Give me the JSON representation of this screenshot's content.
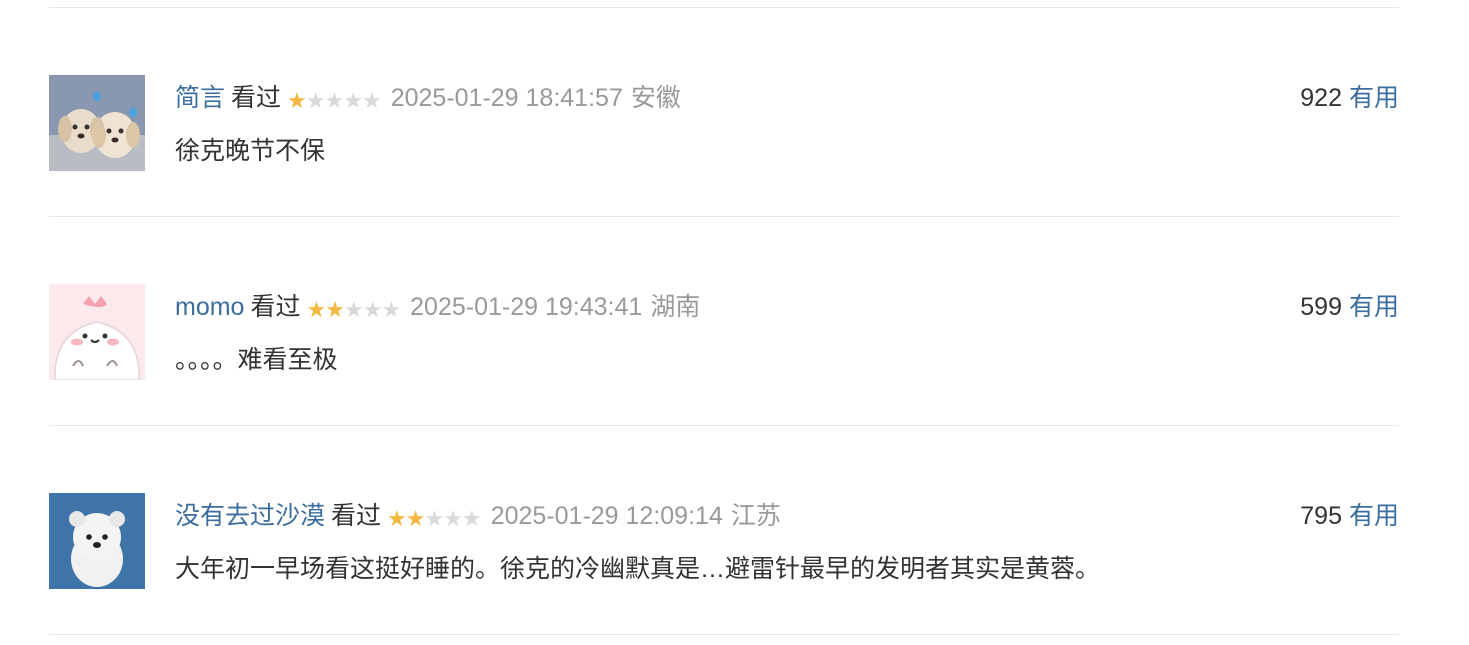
{
  "comments": [
    {
      "user": "简言",
      "status": "看过",
      "rating": 1,
      "rating_max": 5,
      "time": "2025-01-29 18:41:57",
      "location": "安徽",
      "votes": "922",
      "vote_label": "有用",
      "content": "徐克晚节不保"
    },
    {
      "user": "momo",
      "status": "看过",
      "rating": 2,
      "rating_max": 5,
      "time": "2025-01-29 19:43:41",
      "location": "湖南",
      "votes": "599",
      "vote_label": "有用",
      "content": "。。。。难看至极"
    },
    {
      "user": "没有去过沙漠",
      "status": "看过",
      "rating": 2,
      "rating_max": 5,
      "time": "2025-01-29 12:09:14",
      "location": "江苏",
      "votes": "795",
      "vote_label": "有用",
      "content": "大年初一早场看这挺好睡的。徐克的冷幽默真是…避雷针最早的发明者其实是黄蓉。"
    }
  ],
  "colors": {
    "link": "#3b6e9e",
    "star_on": "#f4b740",
    "star_off": "#d9d9d9",
    "muted": "#999999",
    "divider": "#e8e8e8"
  },
  "icons": {
    "star": "star-icon",
    "avatars": [
      "avatar-puppies",
      "avatar-cartoon-blob",
      "avatar-white-bear"
    ]
  }
}
